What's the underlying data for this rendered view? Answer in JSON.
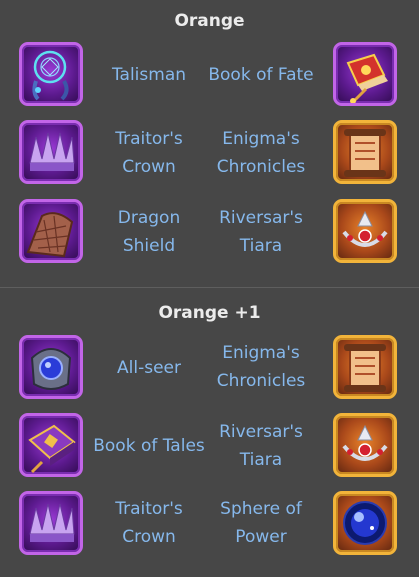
{
  "sections": [
    {
      "title": "Orange",
      "rows": [
        {
          "left": {
            "name": "Talisman",
            "icon": "dreamcatcher-icon",
            "frame": "purple"
          },
          "right": {
            "name": "Book of Fate",
            "icon": "red-book-icon",
            "frame": "purple"
          }
        },
        {
          "left": {
            "name_line1": "Traitor's",
            "name_line2": "Crown",
            "icon": "spiked-crown-icon",
            "frame": "purple"
          },
          "right": {
            "name_line1": "Enigma's",
            "name_line2": "Chronicles",
            "icon": "scroll-icon",
            "frame": "gold"
          }
        },
        {
          "left": {
            "name_line1": "Dragon",
            "name_line2": "Shield",
            "icon": "scale-shield-icon",
            "frame": "purple"
          },
          "right": {
            "name_line1": "Riversar's",
            "name_line2": "Tiara",
            "icon": "tiara-icon",
            "frame": "gold"
          }
        }
      ]
    },
    {
      "title": "Orange +1",
      "rows": [
        {
          "left": {
            "name": "All-seer",
            "icon": "eye-orb-icon",
            "frame": "purple"
          },
          "right": {
            "name_line1": "Enigma's",
            "name_line2": "Chronicles",
            "icon": "scroll-icon",
            "frame": "gold"
          }
        },
        {
          "left": {
            "name": "Book of Tales",
            "icon": "purple-book-icon",
            "frame": "purple"
          },
          "right": {
            "name_line1": "Riversar's",
            "name_line2": "Tiara",
            "icon": "tiara-icon",
            "frame": "gold"
          }
        },
        {
          "left": {
            "name_line1": "Traitor's",
            "name_line2": "Crown",
            "icon": "spiked-crown-icon",
            "frame": "purple"
          },
          "right": {
            "name_line1": "Sphere of",
            "name_line2": "Power",
            "icon": "blue-sphere-icon",
            "frame": "gold"
          }
        }
      ]
    }
  ],
  "colors": {
    "background": "#474747",
    "title": "#ececec",
    "label": "#86b8ec",
    "purple_frame": "#c265e8",
    "gold_frame": "#f2b43a"
  }
}
